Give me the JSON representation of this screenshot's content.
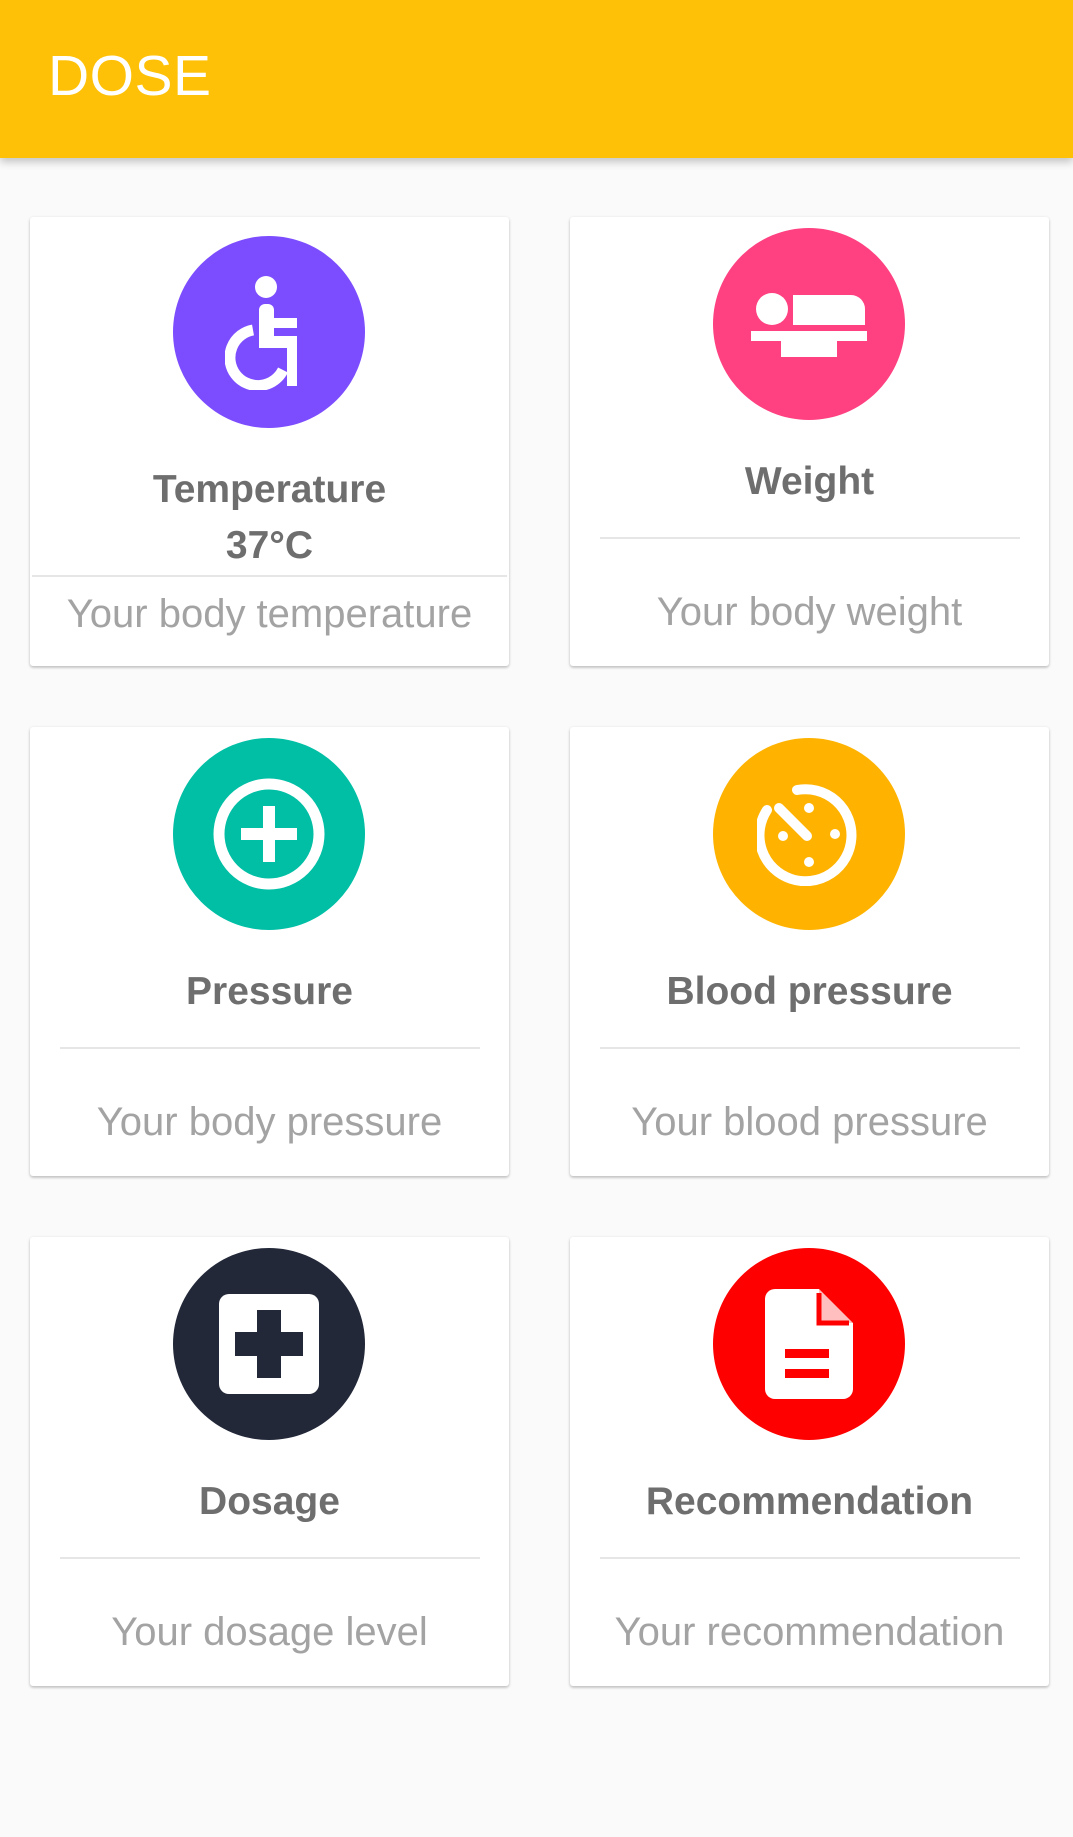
{
  "app": {
    "title": "DOSE"
  },
  "colors": {
    "appbar": "#ffc107",
    "temperature_icon_bg": "#7c4dff",
    "weight_icon_bg": "#ff4081",
    "pressure_icon_bg": "#00bfa5",
    "blood_pressure_icon_bg": "#ffb300",
    "dosage_icon_bg": "#222838",
    "recommendation_icon_bg": "#ff0000"
  },
  "cards": {
    "temperature": {
      "icon": "wheelchair-icon",
      "title": "Temperature",
      "value": "37°C",
      "subtitle": "Your body temperature"
    },
    "weight": {
      "icon": "hotel-bed-icon",
      "title": "Weight",
      "subtitle": "Your body weight"
    },
    "pressure": {
      "icon": "add-circle-outline-icon",
      "title": "Pressure",
      "subtitle": "Your body pressure"
    },
    "blood_pressure": {
      "icon": "gauge-timer-icon",
      "title": "Blood pressure",
      "subtitle": "Your blood pressure"
    },
    "dosage": {
      "icon": "medical-plus-box-icon",
      "title": "Dosage",
      "subtitle": "Your dosage level"
    },
    "recommendation": {
      "icon": "document-icon",
      "title": "Recommendation",
      "subtitle": "Your recommendation"
    }
  }
}
